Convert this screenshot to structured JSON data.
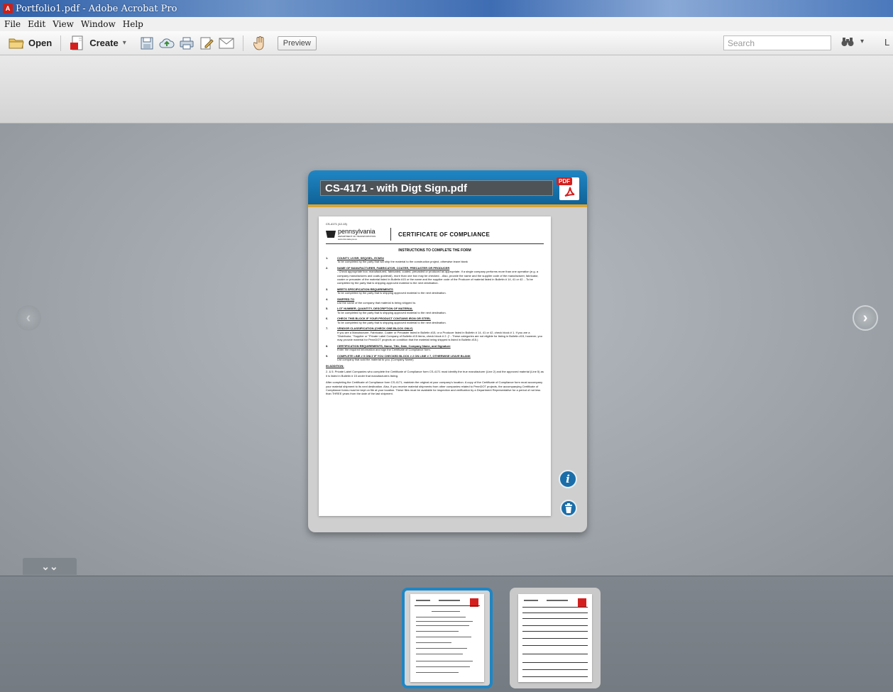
{
  "window": {
    "title": "Portfolio1.pdf - Adobe Acrobat Pro",
    "app_icon_glyph": "A"
  },
  "menu": [
    "File",
    "Edit",
    "View",
    "Window",
    "Help"
  ],
  "toolbar": {
    "open_label": "Open",
    "create_label": "Create",
    "create_caret": "▾",
    "preview_label": "Preview",
    "search_placeholder": "Search",
    "search_caret": "▾",
    "trailing_text": "L"
  },
  "card": {
    "file_title": "CS-4171 - with Digt Sign.pdf",
    "file_type_badge": "PDF"
  },
  "document": {
    "form_code": "CS-4171 (12-13)",
    "org_name": "pennsylvania",
    "org_dept": "DEPARTMENT OF TRANSPORTATION",
    "org_web": "www.dot.state.pa.us",
    "heading": "CERTIFICATE OF COMPLIANCE",
    "instructions_heading": "INSTRUCTIONS TO COMPLETE THE FORM",
    "items": [
      {
        "num": "1.",
        "head": "COUNTY, LIVSR, SEQ/SEL, ECMS#",
        "body": "To be completed by the party that will ship the material to the construction project, otherwise leave blank"
      },
      {
        "num": "2.",
        "head": "NAME OF MANUFACTURER, FABRICATOR, COATER, PRECASTER OR PRODUCER",
        "body": "- Check appropriate box; manufactured, fabricated, coated, precasted or produced as appropriate. If a single company performs more than one operation (e.g. a company manufactures and coats guiderail), more than one box may be checked. - Also, provide the name and the supplier code of the manufacturer, fabricator, coater or precaster of the material listed in Bulletin #15 or the name and the supplier code of the Producer of material listed in Bulletin # 14, 41 or 42. - To be completed by the party that is shipping approved material to the next destination."
      },
      {
        "num": "3.",
        "head": "MEETS SPECIFICATION REQUIREMENTS",
        "body": "To be completed by the party that is shipping approved material to the next destination."
      },
      {
        "num": "4.",
        "head": "SHIPPED TO",
        "body": "List the name of the company that material is being shipped to."
      },
      {
        "num": "5.",
        "head": "LOT NUMBER, QUANTITY, DESCRIPTION OF MATERIAL",
        "body": "To be completed by the party that is shipping approved material to the next destination."
      },
      {
        "num": "6.",
        "head": "CHECK THIS BLOCK IF YOUR PRODUCT CONTAINS IRON OR STEEL",
        "body": "To be completed by the party that is shipping approved material to the next destination."
      },
      {
        "num": "7.",
        "head": "VENDOR CLASSIFICATION (CHECK ONE BLOCK ONLY)",
        "body": "If you are a Manufacturer, Fabricator, Coater or Precaster listed in Bulletin #15, or a Producer listed in Bulletin # 14, 41 or 42, check block # 1. If you are a \"Distributor, \"Supplier or \"Private Label Company of Bulletin #15 items, check block # 2. (* - These categories are not eligible for listing in Bulletin #15, however, you may provide material for PennDOT projects on condition that the material being shipped is listed in Bulletin #15.)"
      },
      {
        "num": "8.",
        "head": "CERTIFICATION REQUIREMENTS, Name, Title, Date, Company Name, and Signature",
        "body": "Enter the required information and sign the Certificate of Compliance form."
      },
      {
        "num": "9.",
        "head": "COMPLETE LINE # 9 ONLY IF YOU CHECKED BLOCK # 2 ON LINE # 7, OTHERWISE LEAVE BLANK",
        "body": "List company that sold the material to you. (Company Name)"
      }
    ],
    "addition_heading": "IN ADDITION:",
    "addition_item": "2. & 5.    Private Label Companies who complete the Certificate of Compliance form CS-4171 must identify the true manufacturer (Line 2) and the approved material (Line 5) as it is listed in Bulletin # 15 under that manufacturers listing.",
    "closing_para": "After completing the Certificate of Compliance form CS-4171, maintain the original at your company's location. A copy of the Certificate of Compliance form must accompany your material shipment to its next destination. Also, if you receive material shipments from other companies related to PennDOT projects, the accompanying Certificate of Compliance forms must be kept on file at your location. These files must be available for inspection and verification by a Department Representative for a period of not less than THREE years from the date of the last shipment."
  },
  "controls": {
    "prev_glyph": "‹",
    "next_glyph": "›",
    "info_glyph": "i",
    "collapse_glyph": "⌄⌄"
  },
  "colors": {
    "accent": "#1f86c4",
    "header_bottom": "#0f5f93",
    "pdf_red": "#d3201f",
    "gold_stripe": "#d9a534"
  }
}
